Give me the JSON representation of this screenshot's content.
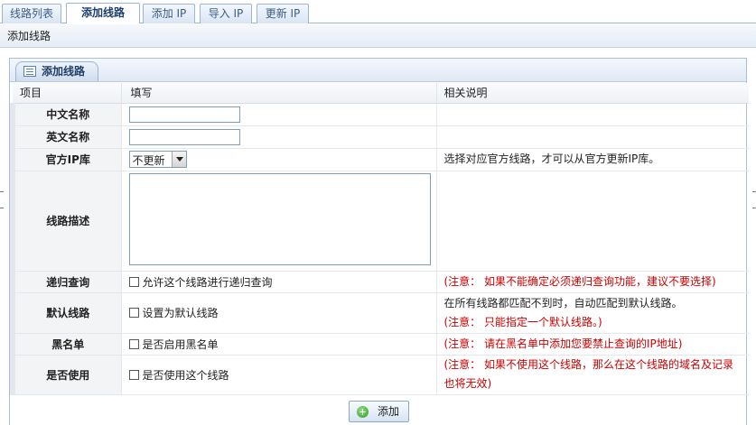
{
  "tabs": [
    {
      "label": "线路列表",
      "active": false
    },
    {
      "label": "添加线路",
      "active": true
    },
    {
      "label": "添加 IP",
      "active": false
    },
    {
      "label": "导入 IP",
      "active": false
    },
    {
      "label": "更新 IP",
      "active": false
    }
  ],
  "breadcrumb": "添加线路",
  "panel": {
    "title": "添加线路"
  },
  "table": {
    "headers": [
      "项目",
      "填写",
      "相关说明"
    ],
    "rows": {
      "cn_name": {
        "label": "中文名称",
        "value": ""
      },
      "en_name": {
        "label": "英文名称",
        "value": ""
      },
      "ip_lib": {
        "label": "官方IP库",
        "selected": "不更新",
        "note": "选择对应官方线路，才可以从官方更新IP库。"
      },
      "desc": {
        "label": "线路描述",
        "value": ""
      },
      "recursive": {
        "label": "递归查询",
        "checkbox": "允许这个线路进行递归查询",
        "note": "(注意： 如果不能确定必须递归查询功能，建议不要选择)"
      },
      "default": {
        "label": "默认线路",
        "checkbox": "设置为默认线路",
        "note1": "在所有线路都匹配不到时，自动匹配到默认线路。",
        "note2": "(注意： 只能指定一个默认线路。)"
      },
      "blacklist": {
        "label": "黑名单",
        "checkbox": "是否启用黑名单",
        "note": "(注意： 请在黑名单中添加您要禁止查询的IP地址)"
      },
      "enabled": {
        "label": "是否使用",
        "checkbox": "是否使用这个线路",
        "note1": "(注意： 如果不使用这个线路，那么在这个线路的域名及记录",
        "note2": "也将无效)"
      }
    }
  },
  "submit_label": "添加",
  "icons": {
    "panel": "table-icon",
    "submit": "add-circle-icon"
  },
  "colors": {
    "accent": "#1f3e68",
    "warning": "#cc0000",
    "border": "#9bb6d6"
  }
}
